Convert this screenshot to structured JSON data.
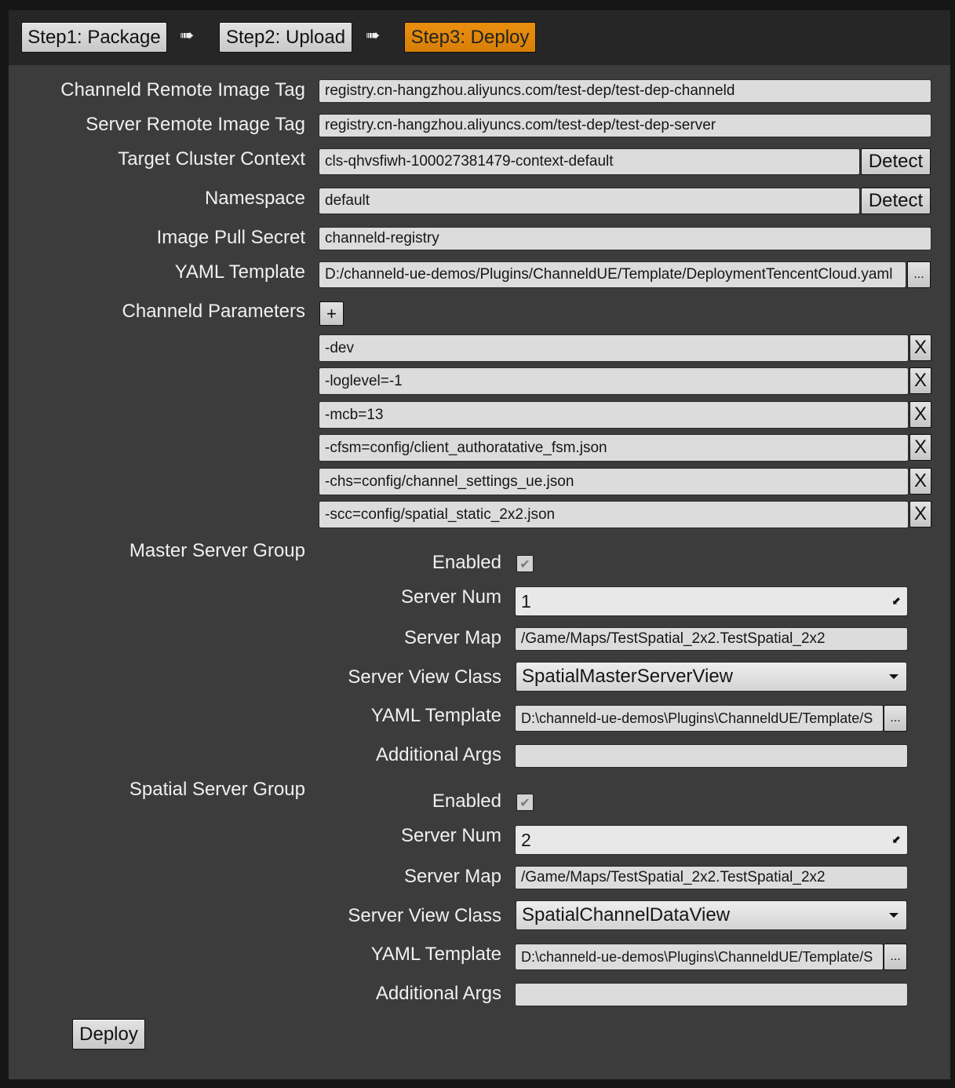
{
  "steps": {
    "package": "Step1: Package",
    "upload": "Step2: Upload",
    "deploy": "Step3: Deploy",
    "arrow": "➠"
  },
  "colors": {
    "active_step": "#e08a0b",
    "panel": "#3c3c3c",
    "topbar": "#262626"
  },
  "fields": {
    "channeld_tag": {
      "label": "Channeld Remote Image Tag",
      "value": "registry.cn-hangzhou.aliyuncs.com/test-dep/test-dep-channeld"
    },
    "server_tag": {
      "label": "Server Remote Image Tag",
      "value": "registry.cn-hangzhou.aliyuncs.com/test-dep/test-dep-server"
    },
    "cluster_context": {
      "label": "Target Cluster Context",
      "value": "cls-qhvsfiwh-100027381479-context-default",
      "button": "Detect"
    },
    "namespace": {
      "label": "Namespace",
      "value": "default",
      "button": "Detect"
    },
    "pull_secret": {
      "label": "Image Pull Secret",
      "value": "channeld-registry"
    },
    "yaml_template": {
      "label": "YAML Template",
      "value": "D:/channeld-ue-demos/Plugins/ChanneldUE/Template/DeploymentTencentCloud.yaml",
      "browse": "..."
    }
  },
  "channeld_params": {
    "label": "Channeld Parameters",
    "add": "+",
    "remove": "X",
    "items": [
      "-dev",
      "-loglevel=-1",
      "-mcb=13",
      "-cfsm=config/client_authoratative_fsm.json",
      "-chs=config/channel_settings_ue.json",
      "-scc=config/spatial_static_2x2.json"
    ]
  },
  "master_group": {
    "title": "Master Server Group",
    "enabled_label": "Enabled",
    "enabled": true,
    "num_label": "Server Num",
    "num": "1",
    "map_label": "Server Map",
    "map": "/Game/Maps/TestSpatial_2x2.TestSpatial_2x2",
    "view_label": "Server View Class",
    "view": "SpatialMasterServerView",
    "yaml_label": "YAML Template",
    "yaml": "D:\\channeld-ue-demos\\Plugins\\ChanneldUE/Template/S",
    "browse": "...",
    "args_label": "Additional Args",
    "args": ""
  },
  "spatial_group": {
    "title": "Spatial Server Group",
    "enabled_label": "Enabled",
    "enabled": true,
    "num_label": "Server Num",
    "num": "2",
    "map_label": "Server Map",
    "map": "/Game/Maps/TestSpatial_2x2.TestSpatial_2x2",
    "view_label": "Server View Class",
    "view": "SpatialChannelDataView",
    "yaml_label": "YAML Template",
    "yaml": "D:\\channeld-ue-demos\\Plugins\\ChanneldUE/Template/S",
    "browse": "...",
    "args_label": "Additional Args",
    "args": ""
  },
  "deploy_button": "Deploy"
}
